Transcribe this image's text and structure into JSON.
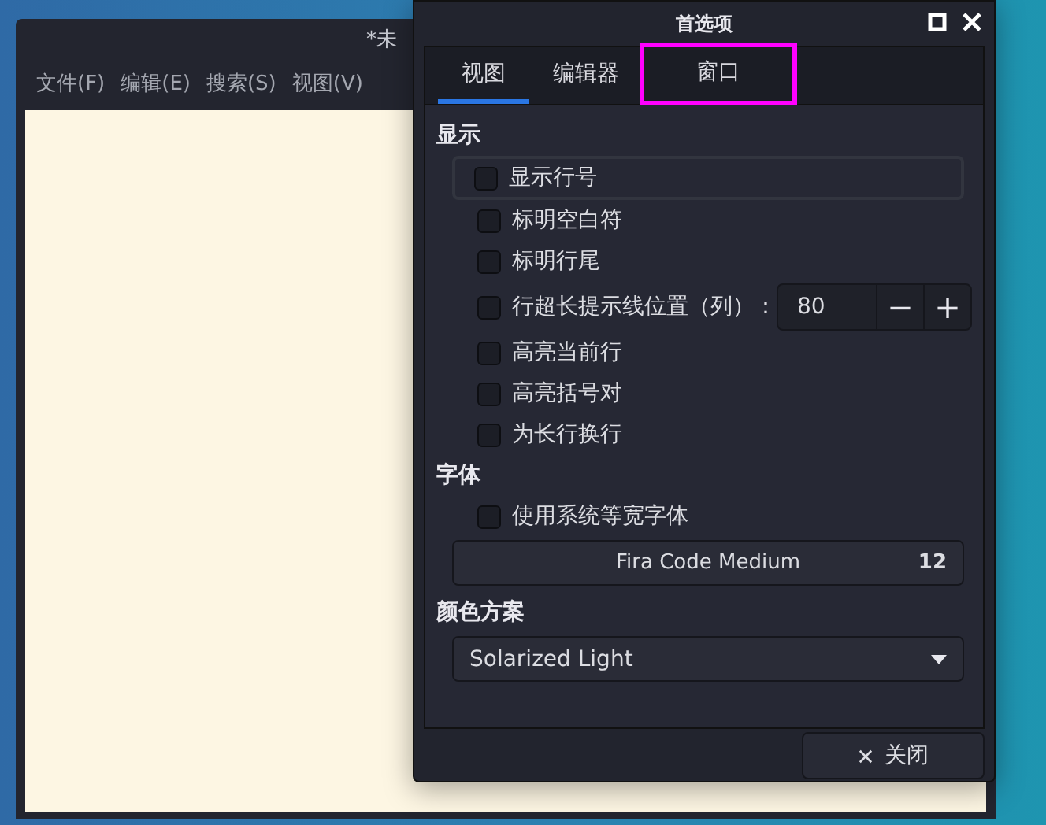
{
  "main_window": {
    "title": "*未",
    "menu": [
      "文件(F)",
      "编辑(E)",
      "搜索(S)",
      "视图(V)"
    ]
  },
  "dialog": {
    "title": "首选项",
    "tabs": [
      {
        "label": "视图",
        "selected": true,
        "highlighted": false
      },
      {
        "label": "编辑器",
        "selected": false,
        "highlighted": false
      },
      {
        "label": "窗口",
        "selected": false,
        "highlighted": true
      }
    ],
    "sections": [
      {
        "heading": "显示",
        "items": [
          {
            "kind": "checkbox",
            "label": "显示行号",
            "checked": false,
            "focused": true
          },
          {
            "kind": "checkbox",
            "label": "标明空白符",
            "checked": false,
            "focused": false
          },
          {
            "kind": "checkbox",
            "label": "标明行尾",
            "checked": false,
            "focused": false
          },
          {
            "kind": "spin",
            "label": "行超长提示线位置（列）：",
            "checked": false,
            "focused": false,
            "value": "80",
            "minus": "−",
            "plus": "+"
          },
          {
            "kind": "checkbox",
            "label": "高亮当前行",
            "checked": false,
            "focused": false
          },
          {
            "kind": "checkbox",
            "label": "高亮括号对",
            "checked": false,
            "focused": false
          },
          {
            "kind": "checkbox",
            "label": "为长行换行",
            "checked": false,
            "focused": false
          }
        ]
      },
      {
        "heading": "字体",
        "items": [
          {
            "kind": "checkbox",
            "label": "使用系统等宽字体",
            "checked": false,
            "focused": false
          },
          {
            "kind": "font",
            "font": "Fira Code Medium",
            "size": "12"
          }
        ]
      },
      {
        "heading": "颜色方案",
        "items": [
          {
            "kind": "dropdown",
            "value": "Solarized Light"
          }
        ]
      }
    ],
    "close_button": "关闭"
  }
}
